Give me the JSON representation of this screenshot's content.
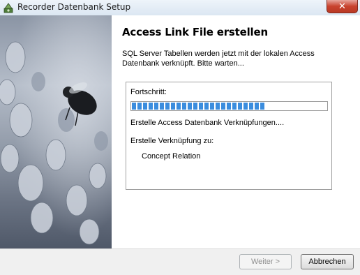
{
  "window": {
    "title": "Recorder Datenbank Setup",
    "close_label": "✕",
    "icon": "installer-icon"
  },
  "content": {
    "heading": "Access Link File erstellen",
    "description": "SQL Server Tabellen werden jetzt mit der lokalen Access Datenbank verknüpft.  Bitte warten...",
    "progress_label": "Fortschritt:",
    "progress_value": 0.68,
    "status_line1": "Erstelle Access Datenbank Verknüpfungen....",
    "status_line2": "Erstelle Verknüpfung zu:",
    "current_item": "Concept Relation"
  },
  "buttons": {
    "next_label": "Weiter >",
    "next_enabled": false,
    "cancel_label": "Abbrechen"
  },
  "colors": {
    "progress": "#3b8dde",
    "close_button": "#c8432e"
  }
}
